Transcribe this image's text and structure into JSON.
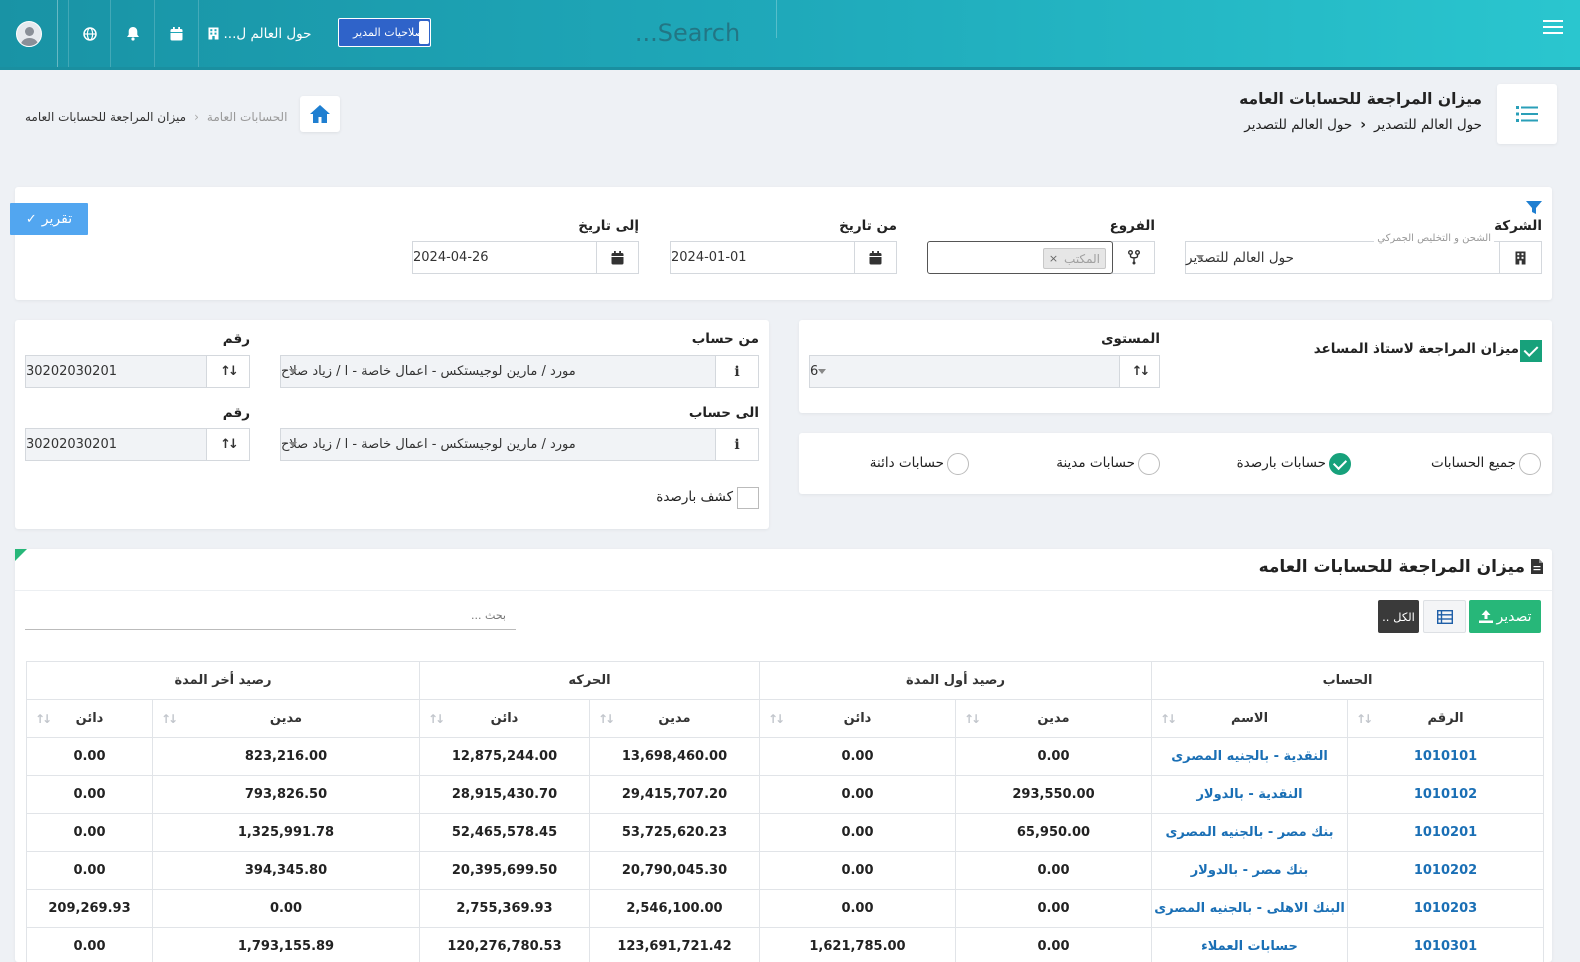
{
  "topbar": {
    "search_placeholder": "Search...",
    "admin_label": "صلاحيات المدير",
    "company_label": "حول العالم ل..."
  },
  "page_header": {
    "title": "ميزان المراجعة للحسابات العامه",
    "crumb_1": "حول العالم للتصدير",
    "crumb_2": "حول العالم للتصدير"
  },
  "breadcrumb": {
    "item_1": "الحسابات العامة",
    "item_2": "ميزان المراجعة للحسابات العامه"
  },
  "filters": {
    "report_button": "تقرير",
    "company_label": "الشركة",
    "company_hint": "الشحن و التخليص الجمركي",
    "company_value": "حول العالم للتصدير",
    "branches_label": "الفروع",
    "branch_tag": "المكتب",
    "from_date_label": "من تاريخ",
    "from_date_value": "2024-01-01",
    "to_date_label": "إلى تاريخ",
    "to_date_value": "2024-04-26"
  },
  "level_panel": {
    "assistant_ledger_label": "ميزان المراجعة لاستاذ المساعد",
    "assistant_ledger_checked": true,
    "level_label": "المستوى",
    "level_value": "6"
  },
  "account_types": {
    "options": [
      "جميع الحسابات",
      "حسابات بارصدة",
      "حسابات مدينة",
      "حسابات دائنة"
    ],
    "selected": "حسابات بارصدة"
  },
  "account_range": {
    "from_account_label": "من حساب",
    "from_account_value": "مورد / مارين لوجيستكس - اعمال خاصة - ا / زياد صلاح",
    "from_number_label": "رقم",
    "from_number_value": "30202030201",
    "to_account_label": "الى حساب",
    "to_account_value": "مورد / مارين لوجيستكس - اعمال خاصة - ا / زياد صلاح",
    "to_number_label": "رقم",
    "to_number_value": "30202030201",
    "balance_statement_label": "كشف بارصدة"
  },
  "report": {
    "title": "ميزان المراجعة للحسابات العامه",
    "export_label": "تصدير",
    "all_label": "الكل ..",
    "search_placeholder": "بحث ...",
    "group_headers": {
      "account": "الحساب",
      "opening": "رصيد أول المدة",
      "movement": "الحركه",
      "closing": "رصيد أخر المدة"
    },
    "columns": {
      "number": "الرقم",
      "name": "الاسم",
      "debit": "مدين",
      "credit": "دائن"
    },
    "rows": [
      {
        "number": "1010101",
        "name": "النقدية - بالجنيه المصرى",
        "open_debit": "0.00",
        "open_credit": "0.00",
        "move_debit": "13,698,460.00",
        "move_credit": "12,875,244.00",
        "close_debit": "823,216.00",
        "close_credit": "0.00"
      },
      {
        "number": "1010102",
        "name": "النقدية - بالدولار",
        "open_debit": "293,550.00",
        "open_credit": "0.00",
        "move_debit": "29,415,707.20",
        "move_credit": "28,915,430.70",
        "close_debit": "793,826.50",
        "close_credit": "0.00"
      },
      {
        "number": "1010201",
        "name": "بنك مصر - بالجنيه المصرى",
        "open_debit": "65,950.00",
        "open_credit": "0.00",
        "move_debit": "53,725,620.23",
        "move_credit": "52,465,578.45",
        "close_debit": "1,325,991.78",
        "close_credit": "0.00"
      },
      {
        "number": "1010202",
        "name": "بنك مصر - بالدولار",
        "open_debit": "0.00",
        "open_credit": "0.00",
        "move_debit": "20,790,045.30",
        "move_credit": "20,395,699.50",
        "close_debit": "394,345.80",
        "close_credit": "0.00"
      },
      {
        "number": "1010203",
        "name": "البنك الاهلى - بالجنيه المصرى",
        "open_debit": "0.00",
        "open_credit": "0.00",
        "move_debit": "2,546,100.00",
        "move_credit": "2,755,369.93",
        "close_debit": "0.00",
        "close_credit": "209,269.93"
      },
      {
        "number": "1010301",
        "name": "حسابات العملاء",
        "open_debit": "0.00",
        "open_credit": "1,621,785.00",
        "move_debit": "123,691,721.42",
        "move_credit": "120,276,780.53",
        "close_debit": "1,793,155.89",
        "close_credit": "0.00"
      }
    ]
  },
  "colors": {
    "topbar_start": "#1993a5",
    "topbar_end": "#2ac6cf",
    "accent_green": "#17a17b",
    "report_button": "#52a6f0",
    "export_button": "#27b779",
    "link_blue": "#1a6fb5"
  }
}
